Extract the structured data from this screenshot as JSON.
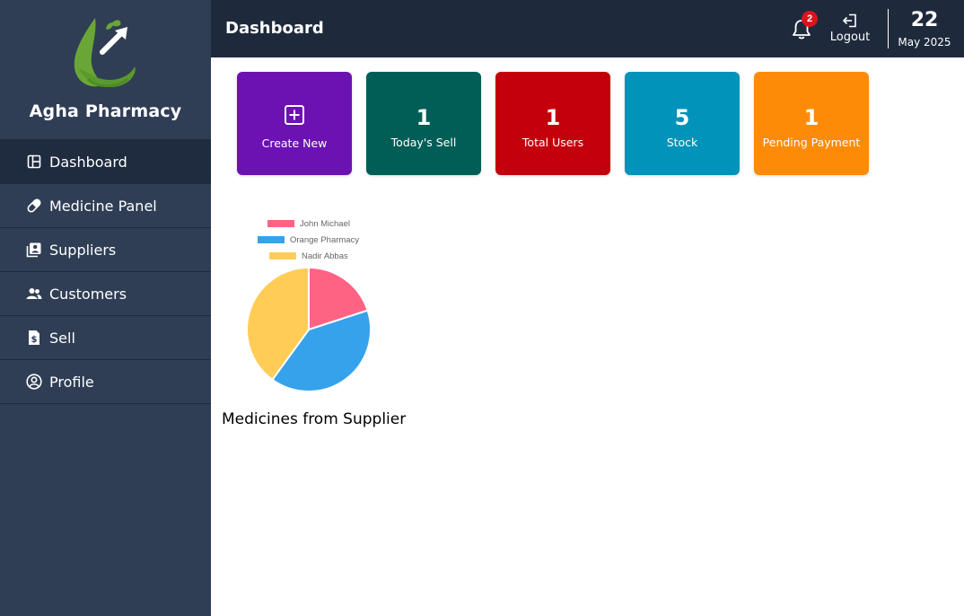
{
  "brand": {
    "name": "Agha Pharmacy",
    "logo_icon": "pharmacy-leaf-logo"
  },
  "sidebar": {
    "items": [
      {
        "label": "Dashboard",
        "icon": "dashboard-icon",
        "active": true
      },
      {
        "label": "Medicine Panel",
        "icon": "pill-icon",
        "active": false
      },
      {
        "label": "Suppliers",
        "icon": "contacts-icon",
        "active": false
      },
      {
        "label": "Customers",
        "icon": "people-icon",
        "active": false
      },
      {
        "label": "Sell",
        "icon": "receipt-dollar-icon",
        "active": false
      },
      {
        "label": "Profile",
        "icon": "user-circle-icon",
        "active": false
      }
    ]
  },
  "header": {
    "title": "Dashboard",
    "notification_count": "2",
    "logout_label": "Logout",
    "date_day": "22",
    "date_month_year": "May 2025"
  },
  "cards": [
    {
      "label": "Create New",
      "value": "",
      "color": "#6c12b2",
      "icon": "plus-square-icon"
    },
    {
      "label": "Today's Sell",
      "value": "1",
      "color": "#015e56"
    },
    {
      "label": "Total Users",
      "value": "1",
      "color": "#c3000b"
    },
    {
      "label": "Stock",
      "value": "5",
      "color": "#0193b9"
    },
    {
      "label": "Pending Payment",
      "value": "1",
      "color": "#fe8b07"
    }
  ],
  "chart_data": {
    "type": "pie",
    "caption": "Medicines from Supplier",
    "legend_position": "top",
    "categories": [
      "John Michael",
      "Orange Pharmacy",
      "Nadir Abbas"
    ],
    "values": [
      1,
      2,
      2
    ],
    "colors": [
      "#ff6384",
      "#36a2eb",
      "#ffcd56"
    ]
  }
}
